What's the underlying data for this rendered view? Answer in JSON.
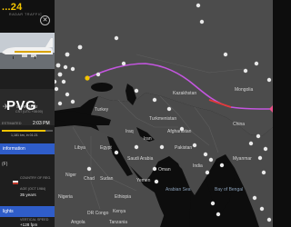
{
  "header": {
    "logo_text": "...24",
    "logo_sub": "RADAR TRAFFIC"
  },
  "flight": {
    "origin_code": "PVG",
    "origin_city": "SHANGHAI",
    "origin_utc": "CST (UTC +08:00)",
    "estimated_label": "ESTIMATED",
    "estimated_time": "2:03 PM",
    "distance_text": "1,181 km, in 01:21",
    "progress": 0.85
  },
  "info": {
    "section_label": "information",
    "aircraft_type": "(F)",
    "country_label": "COUNTRY OF REG.",
    "age_label": "AGE (OCT 1984)",
    "age_value": "35 years"
  },
  "flights": {
    "section_label": "lights",
    "vspeed_label": "VERTICAL SPEED",
    "vspeed_value": "+128 fpm"
  },
  "map_labels": {
    "kazakhstan": "Kazakhstan",
    "mongolia": "Mongolia",
    "turkey": "Turkey",
    "turkmenistan": "Turkmenistan",
    "iraq": "Iraq",
    "iran": "Iran",
    "afghanistan": "Afghanistan",
    "pakistan": "Pakistan",
    "china": "China",
    "libya": "Libya",
    "egypt": "Egypt",
    "saudi_arabia": "Saudi Arabia",
    "oman": "Oman",
    "india": "India",
    "myanmar": "Myanmar",
    "niger": "Niger",
    "chad": "Chad",
    "sudan": "Sudan",
    "yemen": "Yemen",
    "arabian_sea": "Arabian Sea",
    "bay_of_bengal": "Bay of Bengal",
    "ethiopia": "Ethiopia",
    "nigeria": "Nigeria",
    "dr_congo": "DR Congo",
    "kenya": "Kenya",
    "tanzania": "Tanzania",
    "angola": "Angola"
  },
  "colors": {
    "route": "#c456e0",
    "route_segment": "#e03a3a",
    "accent": "#f2c400",
    "section_bar": "#2f5dc9"
  }
}
